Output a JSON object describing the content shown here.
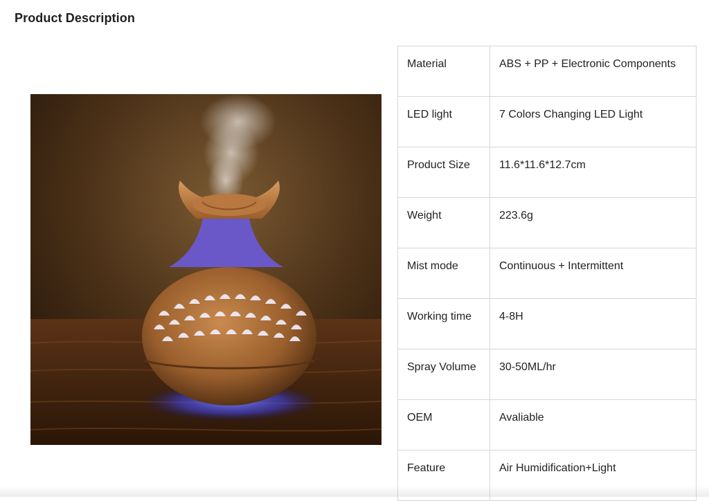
{
  "heading": "Product Description",
  "image": {
    "subject": "wood-grain aroma diffuser product photo"
  },
  "specs": [
    {
      "label": "Material",
      "value": "ABS + PP + Electronic Components"
    },
    {
      "label": "LED light",
      "value": "7 Colors Changing LED Light"
    },
    {
      "label": "Product Size",
      "value": "11.6*11.6*12.7cm"
    },
    {
      "label": "Weight",
      "value": "223.6g"
    },
    {
      "label": "Mist mode",
      "value": "Continuous + Intermittent"
    },
    {
      "label": "Working time",
      "value": "4-8H"
    },
    {
      "label": "Spray Volume",
      "value": "30-50ML/hr"
    },
    {
      "label": "OEM",
      "value": "Avaliable"
    },
    {
      "label": "Feature",
      "value": "Air Humidification+Light"
    }
  ]
}
